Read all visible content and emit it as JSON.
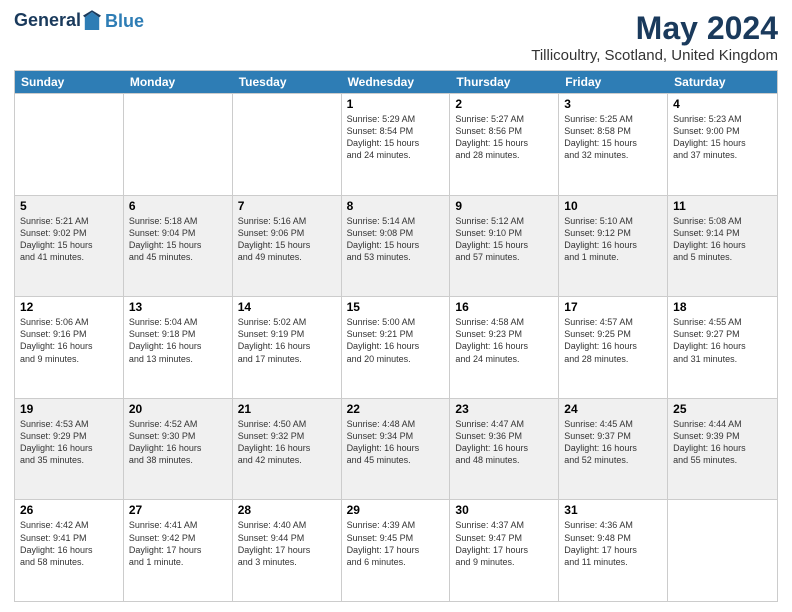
{
  "header": {
    "logo_line1": "General",
    "logo_line2": "Blue",
    "month_year": "May 2024",
    "location": "Tillicoultry, Scotland, United Kingdom"
  },
  "days_of_week": [
    "Sunday",
    "Monday",
    "Tuesday",
    "Wednesday",
    "Thursday",
    "Friday",
    "Saturday"
  ],
  "weeks": [
    [
      {
        "day": "",
        "info": ""
      },
      {
        "day": "",
        "info": ""
      },
      {
        "day": "",
        "info": ""
      },
      {
        "day": "1",
        "info": "Sunrise: 5:29 AM\nSunset: 8:54 PM\nDaylight: 15 hours\nand 24 minutes."
      },
      {
        "day": "2",
        "info": "Sunrise: 5:27 AM\nSunset: 8:56 PM\nDaylight: 15 hours\nand 28 minutes."
      },
      {
        "day": "3",
        "info": "Sunrise: 5:25 AM\nSunset: 8:58 PM\nDaylight: 15 hours\nand 32 minutes."
      },
      {
        "day": "4",
        "info": "Sunrise: 5:23 AM\nSunset: 9:00 PM\nDaylight: 15 hours\nand 37 minutes."
      }
    ],
    [
      {
        "day": "5",
        "info": "Sunrise: 5:21 AM\nSunset: 9:02 PM\nDaylight: 15 hours\nand 41 minutes."
      },
      {
        "day": "6",
        "info": "Sunrise: 5:18 AM\nSunset: 9:04 PM\nDaylight: 15 hours\nand 45 minutes."
      },
      {
        "day": "7",
        "info": "Sunrise: 5:16 AM\nSunset: 9:06 PM\nDaylight: 15 hours\nand 49 minutes."
      },
      {
        "day": "8",
        "info": "Sunrise: 5:14 AM\nSunset: 9:08 PM\nDaylight: 15 hours\nand 53 minutes."
      },
      {
        "day": "9",
        "info": "Sunrise: 5:12 AM\nSunset: 9:10 PM\nDaylight: 15 hours\nand 57 minutes."
      },
      {
        "day": "10",
        "info": "Sunrise: 5:10 AM\nSunset: 9:12 PM\nDaylight: 16 hours\nand 1 minute."
      },
      {
        "day": "11",
        "info": "Sunrise: 5:08 AM\nSunset: 9:14 PM\nDaylight: 16 hours\nand 5 minutes."
      }
    ],
    [
      {
        "day": "12",
        "info": "Sunrise: 5:06 AM\nSunset: 9:16 PM\nDaylight: 16 hours\nand 9 minutes."
      },
      {
        "day": "13",
        "info": "Sunrise: 5:04 AM\nSunset: 9:18 PM\nDaylight: 16 hours\nand 13 minutes."
      },
      {
        "day": "14",
        "info": "Sunrise: 5:02 AM\nSunset: 9:19 PM\nDaylight: 16 hours\nand 17 minutes."
      },
      {
        "day": "15",
        "info": "Sunrise: 5:00 AM\nSunset: 9:21 PM\nDaylight: 16 hours\nand 20 minutes."
      },
      {
        "day": "16",
        "info": "Sunrise: 4:58 AM\nSunset: 9:23 PM\nDaylight: 16 hours\nand 24 minutes."
      },
      {
        "day": "17",
        "info": "Sunrise: 4:57 AM\nSunset: 9:25 PM\nDaylight: 16 hours\nand 28 minutes."
      },
      {
        "day": "18",
        "info": "Sunrise: 4:55 AM\nSunset: 9:27 PM\nDaylight: 16 hours\nand 31 minutes."
      }
    ],
    [
      {
        "day": "19",
        "info": "Sunrise: 4:53 AM\nSunset: 9:29 PM\nDaylight: 16 hours\nand 35 minutes."
      },
      {
        "day": "20",
        "info": "Sunrise: 4:52 AM\nSunset: 9:30 PM\nDaylight: 16 hours\nand 38 minutes."
      },
      {
        "day": "21",
        "info": "Sunrise: 4:50 AM\nSunset: 9:32 PM\nDaylight: 16 hours\nand 42 minutes."
      },
      {
        "day": "22",
        "info": "Sunrise: 4:48 AM\nSunset: 9:34 PM\nDaylight: 16 hours\nand 45 minutes."
      },
      {
        "day": "23",
        "info": "Sunrise: 4:47 AM\nSunset: 9:36 PM\nDaylight: 16 hours\nand 48 minutes."
      },
      {
        "day": "24",
        "info": "Sunrise: 4:45 AM\nSunset: 9:37 PM\nDaylight: 16 hours\nand 52 minutes."
      },
      {
        "day": "25",
        "info": "Sunrise: 4:44 AM\nSunset: 9:39 PM\nDaylight: 16 hours\nand 55 minutes."
      }
    ],
    [
      {
        "day": "26",
        "info": "Sunrise: 4:42 AM\nSunset: 9:41 PM\nDaylight: 16 hours\nand 58 minutes."
      },
      {
        "day": "27",
        "info": "Sunrise: 4:41 AM\nSunset: 9:42 PM\nDaylight: 17 hours\nand 1 minute."
      },
      {
        "day": "28",
        "info": "Sunrise: 4:40 AM\nSunset: 9:44 PM\nDaylight: 17 hours\nand 3 minutes."
      },
      {
        "day": "29",
        "info": "Sunrise: 4:39 AM\nSunset: 9:45 PM\nDaylight: 17 hours\nand 6 minutes."
      },
      {
        "day": "30",
        "info": "Sunrise: 4:37 AM\nSunset: 9:47 PM\nDaylight: 17 hours\nand 9 minutes."
      },
      {
        "day": "31",
        "info": "Sunrise: 4:36 AM\nSunset: 9:48 PM\nDaylight: 17 hours\nand 11 minutes."
      },
      {
        "day": "",
        "info": ""
      }
    ]
  ]
}
